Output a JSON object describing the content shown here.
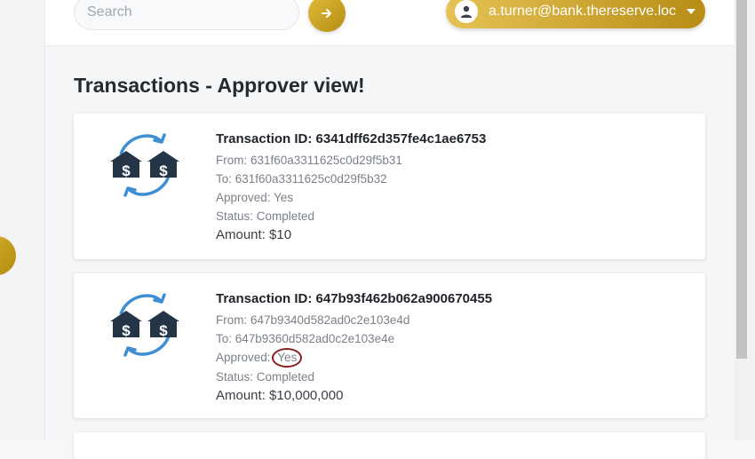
{
  "header": {
    "search": {
      "placeholder": "Search",
      "value": ""
    },
    "go_icon": "arrow-right-icon",
    "user": {
      "email": "a.turner@bank.thereserve.loc",
      "avatar_icon": "user-icon",
      "caret_icon": "caret-down-icon"
    }
  },
  "page": {
    "title": "Transactions - Approver view!"
  },
  "transactions": [
    {
      "id_line": "Transaction ID: 6341dff62d357fe4c1ae6753",
      "from_line": "From: 631f60a3311625c0d29f5b31",
      "to_line": "To: 631f60a3311625c0d29f5b32",
      "approved_label": "Approved: ",
      "approved_value": "Yes",
      "status_line": "Status: Completed",
      "amount_line": "Amount: $10"
    },
    {
      "id_line": "Transaction ID: 647b93f462b062a900670455",
      "from_line": "From: 647b9340d582ad0c2e103e4d",
      "to_line": "To: 647b9360d582ad0c2e103e4e",
      "approved_label": "Approved: ",
      "approved_value": "Yes",
      "status_line": "Status: Completed",
      "amount_line": "Amount: $10,000,000"
    }
  ],
  "colors": {
    "gold_start": "#e6c256",
    "gold_end": "#b78d15",
    "icon_navy": "#243547",
    "icon_blue": "#3d8ed3",
    "annotation": "#8a1d1d"
  }
}
